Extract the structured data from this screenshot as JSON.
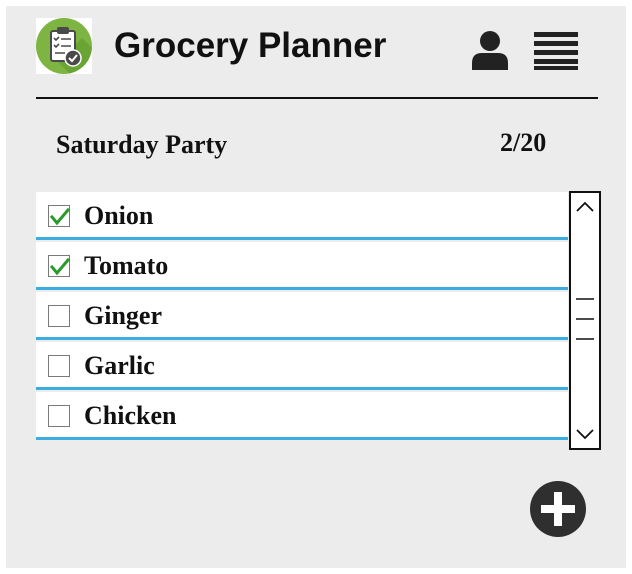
{
  "app": {
    "title": "Grocery Planner",
    "logo_icon": "clipboard-checklist-icon",
    "accent_color": "#7eb442"
  },
  "header": {
    "user_icon": "user-icon",
    "menu_icon": "hamburger-menu-icon"
  },
  "list": {
    "name": "Saturday Party",
    "count": "2/20",
    "underline_color": "#3aaee0",
    "items": [
      {
        "label": "Onion",
        "checked": true
      },
      {
        "label": "Tomato",
        "checked": true
      },
      {
        "label": "Ginger",
        "checked": false
      },
      {
        "label": "Garlic",
        "checked": false
      },
      {
        "label": "Chicken",
        "checked": false
      }
    ]
  },
  "scrollbar": {
    "up_icon": "chevron-up-icon",
    "down_icon": "chevron-down-icon",
    "thumb_icon": "scroll-grip-icon"
  },
  "actions": {
    "add_icon": "plus-circle-icon"
  }
}
